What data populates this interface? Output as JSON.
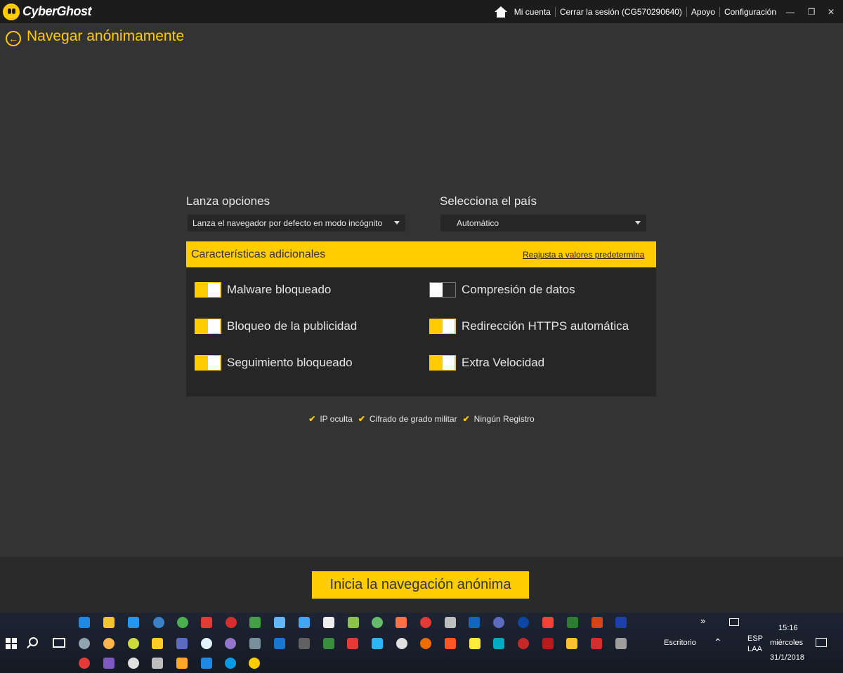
{
  "app": {
    "name": "CyberGhost"
  },
  "topnav": {
    "account": "Mi cuenta",
    "logout": "Cerrar la sesión (CG570290640)",
    "support": "Apoyo",
    "settings": "Configuración"
  },
  "page": {
    "title": "Navegar anónimamente"
  },
  "launch": {
    "label": "Lanza opciones",
    "value": "Lanza el navegador por defecto en modo incógnito"
  },
  "country": {
    "label": "Selecciona el país",
    "value": "Automático"
  },
  "features": {
    "title": "Características adicionales",
    "reset": "Reajusta a valores predetermina",
    "items": [
      {
        "label": "Malware bloqueado",
        "on": true
      },
      {
        "label": "Bloqueo de la publicidad",
        "on": true
      },
      {
        "label": "Seguimiento bloqueado",
        "on": true
      },
      {
        "label": "Compresión de datos",
        "on": false
      },
      {
        "label": "Redirección HTTPS automática",
        "on": true
      },
      {
        "label": "Extra Velocidad",
        "on": true
      }
    ]
  },
  "badges": [
    "IP oculta",
    "Cifrado de grado militar",
    "Ningún Registro"
  ],
  "start_button": "Inicia la navegación anónima",
  "taskbar": {
    "desktop": "Escritorio",
    "lang1": "ESP",
    "lang2": "LAA",
    "time": "15:16",
    "day": "miércoles",
    "date": "31/1/2018"
  },
  "colors": {
    "accent": "#ffcc00",
    "background": "#333333",
    "panel": "#262626",
    "titlebar": "#1c1c1c"
  }
}
